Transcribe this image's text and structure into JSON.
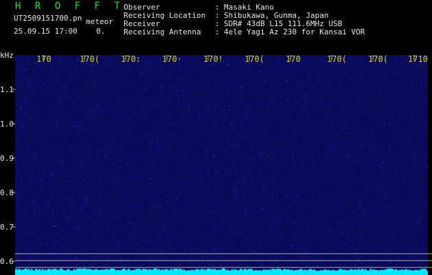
{
  "header": {
    "app_title": "H R O F F T",
    "filename": "UT2509151700.pn",
    "category": "meteor",
    "datetime": "25.09.15 17:00",
    "count": "0.",
    "fields": [
      {
        "label": "Observer",
        "value": "Masaki Kano"
      },
      {
        "label": "Receiving Location",
        "value": "Shibukawa, Gunma, Japan"
      },
      {
        "label": "Receiver",
        "value": "SDR# 43dB L15 111.6MHz USB"
      },
      {
        "label": "Receiving Antenna",
        "value": "4ele Yagi Az 230 for Kansai VOR"
      }
    ],
    "colon": ":"
  },
  "plot": {
    "y_unit": "kHz",
    "y_ticks": [
      "1.1",
      "1.0",
      "0.9",
      "0.8",
      "0.7",
      "0.6"
    ],
    "x_ticks": [
      "170",
      "170(",
      "170:",
      "170·",
      "170!",
      "170(",
      "170",
      "170(",
      "170(",
      "1710"
    ],
    "colors": {
      "background": "#0a0a5a",
      "noise": "#3a3aff",
      "spectrum": "#00e8ff",
      "reference_lines": "#b0b0b0",
      "tick_labels": "#d8d800"
    }
  }
}
